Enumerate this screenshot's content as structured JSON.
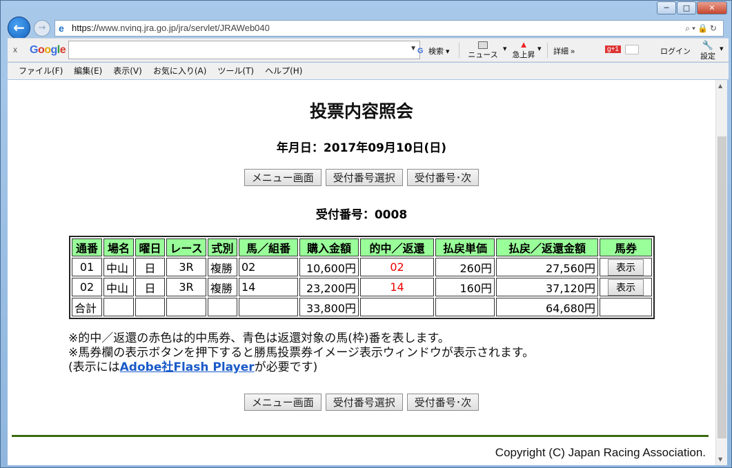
{
  "window": {
    "min": "─",
    "max": "□",
    "close": "✕"
  },
  "browser": {
    "back": "←",
    "forward": "→",
    "url_protocol": "https://",
    "url_rest": "www.nvinq.jra.go.jp/jra/servlet/JRAWeb040",
    "url_controls": "⌕▾🔒↻"
  },
  "toolbar": {
    "close": "x",
    "google": [
      "G",
      "o",
      "o",
      "g",
      "l",
      "e"
    ],
    "search_btn": "検索",
    "news": "ニュース",
    "rising": "急上昇",
    "details": "詳細 »",
    "login": "ログイン",
    "settings": "設定"
  },
  "menu": [
    "ファイル(F)",
    "編集(E)",
    "表示(V)",
    "お気に入り(A)",
    "ツール(T)",
    "ヘルプ(H)"
  ],
  "page": {
    "title": "投票内容照会",
    "date": "年月日：2017年09月10日(日)",
    "buttons": {
      "menu": "メニュー画面",
      "select": "受付番号選択",
      "next": "受付番号･次"
    },
    "receipt": "受付番号：0008",
    "table": {
      "headers": [
        "通番",
        "場名",
        "曜日",
        "レース",
        "式別",
        "馬／組番",
        "購入金額",
        "的中／返還",
        "払戻単価",
        "払戻／返還金額",
        "馬券"
      ],
      "rows": [
        [
          "01",
          "中山",
          "日",
          "3R",
          "複勝",
          "02",
          "10,600円",
          "02",
          "260円",
          "27,560円",
          "表示"
        ],
        [
          "02",
          "中山",
          "日",
          "3R",
          "複勝",
          "14",
          "23,200円",
          "14",
          "160円",
          "37,120円",
          "表示"
        ]
      ],
      "total_label": "合計",
      "total_purchase": "33,800円",
      "total_payout": "64,680円"
    },
    "notes": {
      "line1": "※的中／返還の赤色は的中馬券、青色は返還対象の馬(枠)番を表します。",
      "line2": "※馬券欄の表示ボタンを押下すると勝馬投票券イメージ表示ウィンドウが表示されます。",
      "line3_pre": "(表示には",
      "line3_link": "Adobe社Flash Player",
      "line3_post": "が必要です)"
    },
    "copyright": "Copyright (C) Japan Racing Association."
  }
}
